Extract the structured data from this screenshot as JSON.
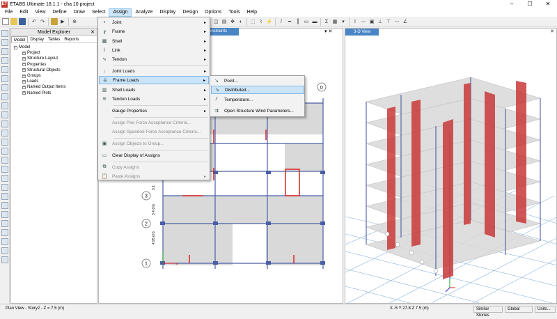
{
  "app": {
    "title": "ETABS Ultimate 18.1.1 - cha 10 project",
    "logo": "ET"
  },
  "window_buttons": [
    "–",
    "☐",
    "✕"
  ],
  "menu": [
    "File",
    "Edit",
    "View",
    "Define",
    "Draw",
    "Select",
    "Assign",
    "Analyze",
    "Display",
    "Design",
    "Options",
    "Tools",
    "Help"
  ],
  "active_menu": "Assign",
  "explorer": {
    "title": "Model Explorer",
    "close": "✕",
    "tabs": [
      "Model",
      "Display",
      "Tables",
      "Reports"
    ],
    "root": "Model",
    "items": [
      "Project",
      "Structure Layout",
      "Properties",
      "Structural Objects",
      "Groups",
      "Loads",
      "Named Output Items",
      "Named Plots"
    ]
  },
  "plan_view": {
    "tab_label": "onstraints",
    "close": "✕",
    "pin": "▾"
  },
  "view3d": {
    "tab_label": "3-D View",
    "close": "✕"
  },
  "assign_menu": {
    "items": [
      {
        "label": "Joint",
        "icon": "joint-icon",
        "arrow": "▸"
      },
      {
        "label": "Frame",
        "icon": "frame-icon",
        "arrow": "▸"
      },
      {
        "label": "Shell",
        "icon": "shell-icon",
        "arrow": "▸"
      },
      {
        "label": "Link",
        "icon": "link-icon",
        "arrow": "▸"
      },
      {
        "label": "Tendon",
        "icon": "tendon-icon",
        "arrow": "▸"
      },
      {
        "label": "Joint Loads",
        "icon": "joint-loads-icon",
        "arrow": "▸"
      },
      {
        "label": "Frame Loads",
        "icon": "frame-loads-icon",
        "arrow": "▸"
      },
      {
        "label": "Shell Loads",
        "icon": "shell-loads-icon",
        "arrow": "▸"
      },
      {
        "label": "Tendon Loads",
        "icon": "tendon-loads-icon",
        "arrow": "▸"
      },
      {
        "label": "Gauge Properties",
        "icon": "",
        "arrow": "▸"
      },
      {
        "label": "Assign Pier Force Acceptance Criteria...",
        "icon": "",
        "arrow": ""
      },
      {
        "label": "Assign Spandrel Force Acceptance Criteria...",
        "icon": "",
        "arrow": ""
      },
      {
        "label": "Assign Objects to Group...",
        "icon": "group-icon",
        "arrow": ""
      },
      {
        "label": "Clear Display of Assigns",
        "icon": "clear-display-icon",
        "arrow": ""
      },
      {
        "label": "Copy Assigns",
        "icon": "copy-icon",
        "arrow": ""
      },
      {
        "label": "Paste Assigns",
        "icon": "paste-icon",
        "arrow": "▸"
      }
    ]
  },
  "frame_loads_submenu": {
    "items": [
      {
        "label": "Point...",
        "icon": "point-load-icon"
      },
      {
        "label": "Distributed...",
        "icon": "distributed-load-icon"
      },
      {
        "label": "Temperature...",
        "icon": "temperature-icon"
      },
      {
        "label": "Open Structure Wind Parameters...",
        "icon": "wind-icon"
      }
    ]
  },
  "grid_labels": {
    "bubbles": [
      "1",
      "2",
      "3",
      "D"
    ],
    "dims": [
      "4.95 (m)",
      "3.4 (m)",
      "3.1"
    ]
  },
  "status": {
    "left": "Plan View - Story2 - Z = 7.5 (m)",
    "coords": "X -5  Y 27.8  Z 7.5 (m)",
    "stories": "Similar Stories",
    "coord_sys": "Global",
    "units": "Units..."
  }
}
